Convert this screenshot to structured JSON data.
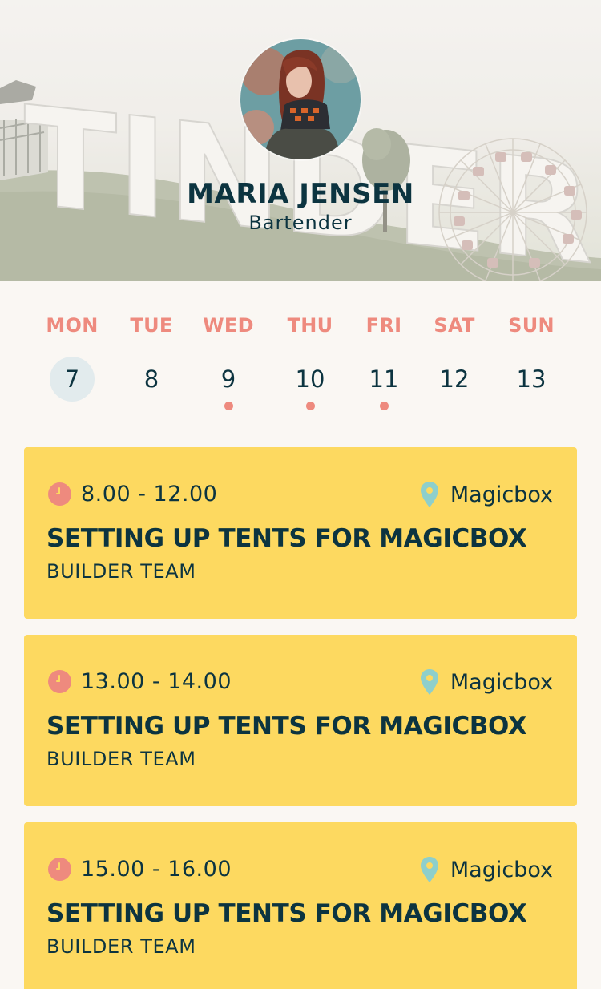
{
  "profile": {
    "name": "MARIA JENSEN",
    "role": "Bartender",
    "hero_sign_text": "TINDERBOX"
  },
  "week": {
    "days": [
      {
        "name": "MON",
        "date": "7",
        "selected": true,
        "has_events": false
      },
      {
        "name": "TUE",
        "date": "8",
        "selected": false,
        "has_events": false
      },
      {
        "name": "WED",
        "date": "9",
        "selected": false,
        "has_events": true
      },
      {
        "name": "THU",
        "date": "10",
        "selected": false,
        "has_events": true
      },
      {
        "name": "FRI",
        "date": "11",
        "selected": false,
        "has_events": true
      },
      {
        "name": "SAT",
        "date": "12",
        "selected": false,
        "has_events": false
      },
      {
        "name": "SUN",
        "date": "13",
        "selected": false,
        "has_events": false
      }
    ]
  },
  "shifts": [
    {
      "time": "8.00 - 12.00",
      "location": "Magicbox",
      "title": "SETTING UP TENTS FOR MAGICBOX",
      "team": "BUILDER TEAM"
    },
    {
      "time": "13.00 - 14.00",
      "location": "Magicbox",
      "title": "SETTING UP TENTS FOR MAGICBOX",
      "team": "BUILDER TEAM"
    },
    {
      "time": "15.00 - 16.00",
      "location": "Magicbox",
      "title": "SETTING UP TENTS FOR MAGICBOX",
      "team": "BUILDER TEAM"
    }
  ],
  "colors": {
    "accent_coral": "#ee8a7e",
    "card_yellow": "#fdd960",
    "text_navy": "#0c3440",
    "pin_teal": "#8ecfcb",
    "selected_bg": "#e2ebed",
    "page_bg": "#faf7f3"
  },
  "icons": {
    "time": "clock-icon",
    "location": "location-pin-icon"
  }
}
